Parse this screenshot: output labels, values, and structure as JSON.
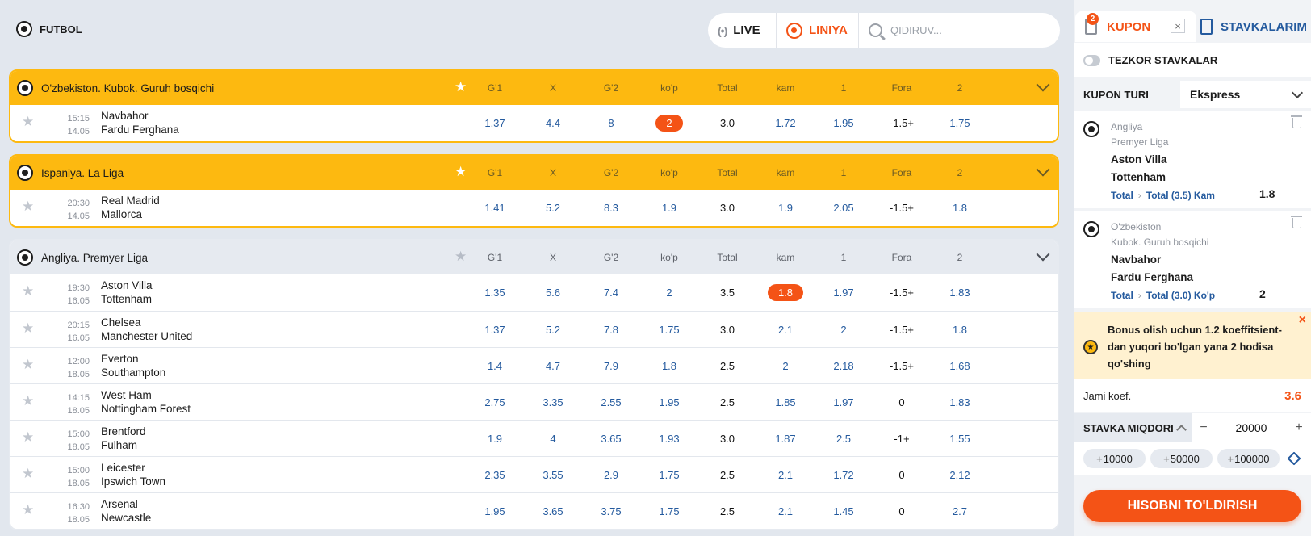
{
  "sport": {
    "label": "FUTBOL"
  },
  "modes": {
    "live": "LIVE",
    "liniya": "LINIYA",
    "search_placeholder": "QIDIRUV..."
  },
  "leagues": [
    {
      "name": "O'zbekiston. Kubok. Guruh bosqichi",
      "style": "yellow",
      "columns": [
        "G'1",
        "X",
        "G'2",
        "ko'p",
        "Total",
        "kam",
        "1",
        "Fora",
        "2"
      ],
      "matches": [
        {
          "time": "15:15",
          "date": "14.05",
          "team1": "Navbahor",
          "team2": "Fardu Ferghana",
          "odds": [
            "1.37",
            "4.4",
            "8",
            "2",
            "3.0",
            "1.72",
            "1.95",
            "-1.5+",
            "1.75"
          ],
          "selected_index": 3
        }
      ]
    },
    {
      "name": "Ispaniya. La Liga",
      "style": "yellow",
      "columns": [
        "G'1",
        "X",
        "G'2",
        "ko'p",
        "Total",
        "kam",
        "1",
        "Fora",
        "2"
      ],
      "matches": [
        {
          "time": "20:30",
          "date": "14.05",
          "team1": "Real Madrid",
          "team2": "Mallorca",
          "odds": [
            "1.41",
            "5.2",
            "8.3",
            "1.9",
            "3.0",
            "1.9",
            "2.05",
            "-1.5+",
            "1.8"
          ],
          "selected_index": -1
        }
      ]
    },
    {
      "name": "Angliya. Premyer Liga",
      "style": "grey",
      "columns": [
        "G'1",
        "X",
        "G'2",
        "ko'p",
        "Total",
        "kam",
        "1",
        "Fora",
        "2"
      ],
      "matches": [
        {
          "time": "19:30",
          "date": "16.05",
          "team1": "Aston Villa",
          "team2": "Tottenham",
          "odds": [
            "1.35",
            "5.6",
            "7.4",
            "2",
            "3.5",
            "1.8",
            "1.97",
            "-1.5+",
            "1.83"
          ],
          "selected_index": 5
        },
        {
          "time": "20:15",
          "date": "16.05",
          "team1": "Chelsea",
          "team2": "Manchester United",
          "odds": [
            "1.37",
            "5.2",
            "7.8",
            "1.75",
            "3.0",
            "2.1",
            "2",
            "-1.5+",
            "1.8"
          ],
          "selected_index": -1
        },
        {
          "time": "12:00",
          "date": "18.05",
          "team1": "Everton",
          "team2": "Southampton",
          "odds": [
            "1.4",
            "4.7",
            "7.9",
            "1.8",
            "2.5",
            "2",
            "2.18",
            "-1.5+",
            "1.68"
          ],
          "selected_index": -1
        },
        {
          "time": "14:15",
          "date": "18.05",
          "team1": "West Ham",
          "team2": "Nottingham Forest",
          "odds": [
            "2.75",
            "3.35",
            "2.55",
            "1.95",
            "2.5",
            "1.85",
            "1.97",
            "0",
            "1.83"
          ],
          "selected_index": -1
        },
        {
          "time": "15:00",
          "date": "18.05",
          "team1": "Brentford",
          "team2": "Fulham",
          "odds": [
            "1.9",
            "4",
            "3.65",
            "1.93",
            "3.0",
            "1.87",
            "2.5",
            "-1+",
            "1.55"
          ],
          "selected_index": -1
        },
        {
          "time": "15:00",
          "date": "18.05",
          "team1": "Leicester",
          "team2": "Ipswich Town",
          "odds": [
            "2.35",
            "3.55",
            "2.9",
            "1.75",
            "2.5",
            "2.1",
            "1.72",
            "0",
            "2.12"
          ],
          "selected_index": -1
        },
        {
          "time": "16:30",
          "date": "18.05",
          "team1": "Arsenal",
          "team2": "Newcastle",
          "odds": [
            "1.95",
            "3.65",
            "3.75",
            "1.75",
            "2.5",
            "2.1",
            "1.45",
            "0",
            "2.7"
          ],
          "selected_index": -1
        }
      ]
    }
  ],
  "coupon": {
    "tab_label": "KUPON",
    "badge_count": "2",
    "close_symbol": "×",
    "stavkalarim_label": "STAVKALARIM",
    "tezkor_label": "TEZKOR STAVKALAR",
    "kupon_turi_label": "KUPON TURI",
    "kupon_turi_value": "Ekspress",
    "bets": [
      {
        "league1": "Angliya",
        "league2": "Premyer Liga",
        "team1": "Aston Villa",
        "team2": "Tottenham",
        "market": "Total",
        "selection": "Total (3.5) Kam",
        "odd": "1.8"
      },
      {
        "league1": "O'zbekiston",
        "league2": "Kubok. Guruh bosqichi",
        "team1": "Navbahor",
        "team2": "Fardu Ferghana",
        "market": "Total",
        "selection": "Total (3.0) Ko'p",
        "odd": "2"
      }
    ],
    "bonus_text": "Bonus olish uchun 1.2 koeffitsient-dan yuqori bo'lgan yana 2 hodisa qo'shing",
    "jami_label": "Jami koef.",
    "jami_value": "3.6",
    "stavka_label": "STAVKA MIQDORI",
    "stavka_value": "20000",
    "minus": "−",
    "plus": "+",
    "quick_amounts": [
      "10000",
      "50000",
      "100000"
    ],
    "fill_button": "HISOBNI TO'LDIRISH"
  },
  "colors": {
    "accent": "#f45316",
    "league_yellow": "#fdb910",
    "odd_blue": "#245a9e"
  }
}
